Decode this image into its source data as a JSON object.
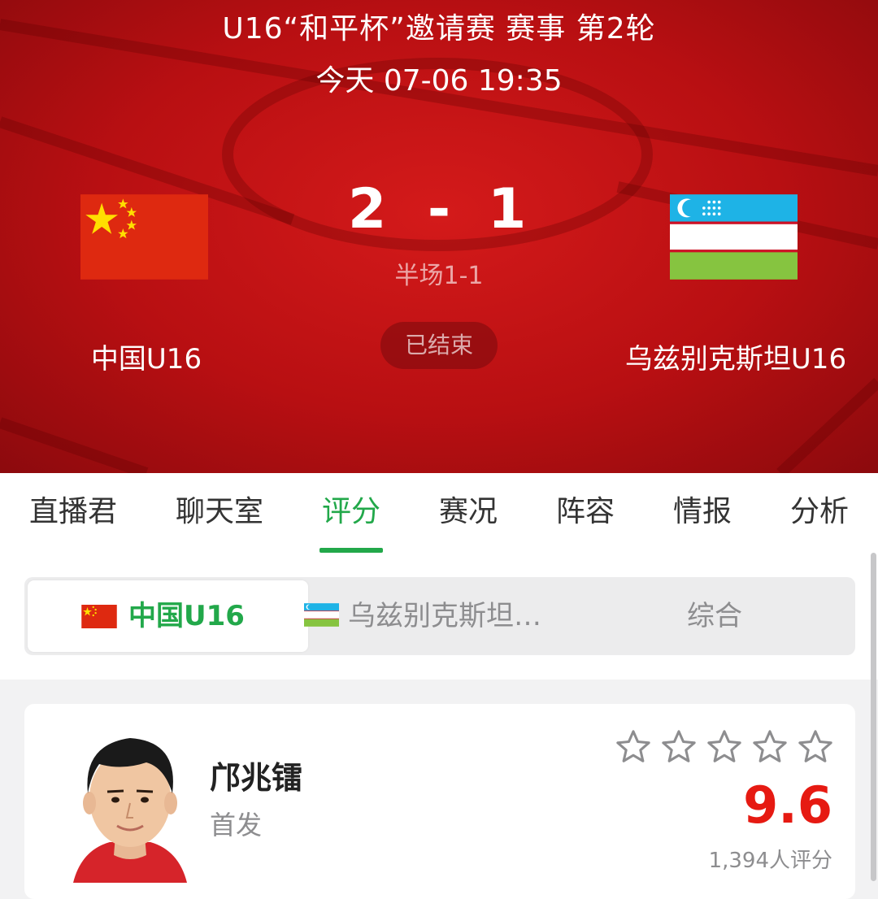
{
  "match": {
    "title": "U16“和平杯”邀请赛 赛事 第2轮",
    "datetime": "今天 07-06 19:35",
    "home_team": "中国U16",
    "away_team": "乌兹别克斯坦U16",
    "home_score": "2",
    "separator": "-",
    "away_score": "1",
    "halftime": "半场1-1",
    "status": "已结束"
  },
  "tabs": [
    {
      "label": "直播君"
    },
    {
      "label": "聊天室"
    },
    {
      "label": "评分",
      "active": true
    },
    {
      "label": "赛况"
    },
    {
      "label": "阵容"
    },
    {
      "label": "情报"
    },
    {
      "label": "分析"
    }
  ],
  "segment": {
    "home_label": "中国U16",
    "away_label": "乌兹别克斯坦…",
    "all_label": "综合",
    "selected": "home"
  },
  "player": {
    "name": "邝兆镭",
    "role": "首发",
    "rating": "9.6",
    "rating_count": "1,394人评分",
    "stars_filled": 0,
    "stars_total": 5
  },
  "colors": {
    "accent_green": "#22a84a",
    "rating_red": "#e61a12",
    "header_red": "#c0101a"
  },
  "icons": {
    "home_flag": "china-flag-icon",
    "away_flag": "uzbekistan-flag-icon",
    "star": "star-outline-icon"
  }
}
